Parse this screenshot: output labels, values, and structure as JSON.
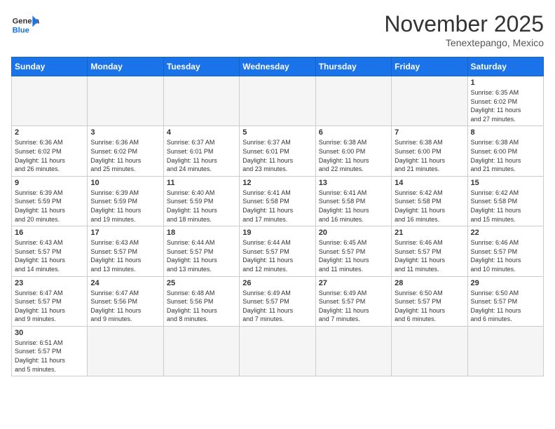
{
  "header": {
    "logo_line1": "General",
    "logo_line2": "Blue",
    "month_title": "November 2025",
    "location": "Tenextepango, Mexico"
  },
  "days_of_week": [
    "Sunday",
    "Monday",
    "Tuesday",
    "Wednesday",
    "Thursday",
    "Friday",
    "Saturday"
  ],
  "weeks": [
    [
      {
        "day": "",
        "info": ""
      },
      {
        "day": "",
        "info": ""
      },
      {
        "day": "",
        "info": ""
      },
      {
        "day": "",
        "info": ""
      },
      {
        "day": "",
        "info": ""
      },
      {
        "day": "",
        "info": ""
      },
      {
        "day": "1",
        "info": "Sunrise: 6:35 AM\nSunset: 6:02 PM\nDaylight: 11 hours\nand 27 minutes."
      }
    ],
    [
      {
        "day": "2",
        "info": "Sunrise: 6:36 AM\nSunset: 6:02 PM\nDaylight: 11 hours\nand 26 minutes."
      },
      {
        "day": "3",
        "info": "Sunrise: 6:36 AM\nSunset: 6:02 PM\nDaylight: 11 hours\nand 25 minutes."
      },
      {
        "day": "4",
        "info": "Sunrise: 6:37 AM\nSunset: 6:01 PM\nDaylight: 11 hours\nand 24 minutes."
      },
      {
        "day": "5",
        "info": "Sunrise: 6:37 AM\nSunset: 6:01 PM\nDaylight: 11 hours\nand 23 minutes."
      },
      {
        "day": "6",
        "info": "Sunrise: 6:38 AM\nSunset: 6:00 PM\nDaylight: 11 hours\nand 22 minutes."
      },
      {
        "day": "7",
        "info": "Sunrise: 6:38 AM\nSunset: 6:00 PM\nDaylight: 11 hours\nand 21 minutes."
      },
      {
        "day": "8",
        "info": "Sunrise: 6:38 AM\nSunset: 6:00 PM\nDaylight: 11 hours\nand 21 minutes."
      }
    ],
    [
      {
        "day": "9",
        "info": "Sunrise: 6:39 AM\nSunset: 5:59 PM\nDaylight: 11 hours\nand 20 minutes."
      },
      {
        "day": "10",
        "info": "Sunrise: 6:39 AM\nSunset: 5:59 PM\nDaylight: 11 hours\nand 19 minutes."
      },
      {
        "day": "11",
        "info": "Sunrise: 6:40 AM\nSunset: 5:59 PM\nDaylight: 11 hours\nand 18 minutes."
      },
      {
        "day": "12",
        "info": "Sunrise: 6:41 AM\nSunset: 5:58 PM\nDaylight: 11 hours\nand 17 minutes."
      },
      {
        "day": "13",
        "info": "Sunrise: 6:41 AM\nSunset: 5:58 PM\nDaylight: 11 hours\nand 16 minutes."
      },
      {
        "day": "14",
        "info": "Sunrise: 6:42 AM\nSunset: 5:58 PM\nDaylight: 11 hours\nand 16 minutes."
      },
      {
        "day": "15",
        "info": "Sunrise: 6:42 AM\nSunset: 5:58 PM\nDaylight: 11 hours\nand 15 minutes."
      }
    ],
    [
      {
        "day": "16",
        "info": "Sunrise: 6:43 AM\nSunset: 5:57 PM\nDaylight: 11 hours\nand 14 minutes."
      },
      {
        "day": "17",
        "info": "Sunrise: 6:43 AM\nSunset: 5:57 PM\nDaylight: 11 hours\nand 13 minutes."
      },
      {
        "day": "18",
        "info": "Sunrise: 6:44 AM\nSunset: 5:57 PM\nDaylight: 11 hours\nand 13 minutes."
      },
      {
        "day": "19",
        "info": "Sunrise: 6:44 AM\nSunset: 5:57 PM\nDaylight: 11 hours\nand 12 minutes."
      },
      {
        "day": "20",
        "info": "Sunrise: 6:45 AM\nSunset: 5:57 PM\nDaylight: 11 hours\nand 11 minutes."
      },
      {
        "day": "21",
        "info": "Sunrise: 6:46 AM\nSunset: 5:57 PM\nDaylight: 11 hours\nand 11 minutes."
      },
      {
        "day": "22",
        "info": "Sunrise: 6:46 AM\nSunset: 5:57 PM\nDaylight: 11 hours\nand 10 minutes."
      }
    ],
    [
      {
        "day": "23",
        "info": "Sunrise: 6:47 AM\nSunset: 5:57 PM\nDaylight: 11 hours\nand 9 minutes."
      },
      {
        "day": "24",
        "info": "Sunrise: 6:47 AM\nSunset: 5:56 PM\nDaylight: 11 hours\nand 9 minutes."
      },
      {
        "day": "25",
        "info": "Sunrise: 6:48 AM\nSunset: 5:56 PM\nDaylight: 11 hours\nand 8 minutes."
      },
      {
        "day": "26",
        "info": "Sunrise: 6:49 AM\nSunset: 5:57 PM\nDaylight: 11 hours\nand 7 minutes."
      },
      {
        "day": "27",
        "info": "Sunrise: 6:49 AM\nSunset: 5:57 PM\nDaylight: 11 hours\nand 7 minutes."
      },
      {
        "day": "28",
        "info": "Sunrise: 6:50 AM\nSunset: 5:57 PM\nDaylight: 11 hours\nand 6 minutes."
      },
      {
        "day": "29",
        "info": "Sunrise: 6:50 AM\nSunset: 5:57 PM\nDaylight: 11 hours\nand 6 minutes."
      }
    ],
    [
      {
        "day": "30",
        "info": "Sunrise: 6:51 AM\nSunset: 5:57 PM\nDaylight: 11 hours\nand 5 minutes."
      },
      {
        "day": "",
        "info": ""
      },
      {
        "day": "",
        "info": ""
      },
      {
        "day": "",
        "info": ""
      },
      {
        "day": "",
        "info": ""
      },
      {
        "day": "",
        "info": ""
      },
      {
        "day": "",
        "info": ""
      }
    ]
  ]
}
